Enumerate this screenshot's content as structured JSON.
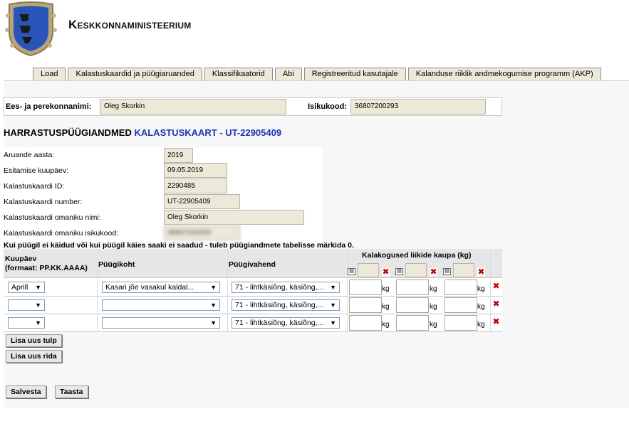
{
  "header": {
    "title": "Keskkonnaministeerium"
  },
  "tabs": [
    "Load",
    "Kalastuskaardid ja püügiaruanded",
    "Klassifikaatorid",
    "Abi",
    "Registreeritud kasutajale",
    "Kalanduse riiklik andmekogumise programm (AKP)"
  ],
  "person": {
    "name_label": "Ees- ja perekonnanimi:",
    "name_value": "Oleg Skorkin",
    "id_label": "Isikukood:",
    "id_value": "36807200293"
  },
  "heading": {
    "main": "HARRASTUSPÜÜGIANDMED",
    "sub": "KALASTUSKAART - UT-22905409"
  },
  "info": [
    {
      "label": "Aruande aasta:",
      "value": "2019"
    },
    {
      "label": "Esitamise kuupäev:",
      "value": "09.05.2019"
    },
    {
      "label": "Kalastuskaardi ID:",
      "value": "2290485"
    },
    {
      "label": "Kalastuskaardi number:",
      "value": "UT-22905409"
    },
    {
      "label": "Kalastuskaardi omaniku nimi:",
      "value": "Oleg Skorkin"
    },
    {
      "label": "Kalastuskaardi omaniku isikukood:",
      "value": "36807200293"
    }
  ],
  "notice": "Kui püügil ei käidud või kui püügil käies saaki ei saadud - tuleb püügiandmete tabelisse märkida 0.",
  "table": {
    "col_date_line1": "Kuupäev",
    "col_date_line2": "(formaat: PP.KK.AAAA)",
    "col_place": "Püügikoht",
    "col_gear": "Püügivahend",
    "col_catch": "Kalakogused liikide kaupa (kg)",
    "unit": "kg",
    "rows": [
      {
        "date": "Aprill",
        "place": "Kasari jõe vasakul kaldal...",
        "gear": "71 - lihtkäsiõng, käsiõng,..."
      },
      {
        "date": "",
        "place": "",
        "gear": "71 - lihtkäsiõng, käsiõng,..."
      },
      {
        "date": "",
        "place": "",
        "gear": "71 - lihtkäsiõng, käsiõng,..."
      }
    ]
  },
  "buttons": {
    "add_column": "Lisa uus tulp",
    "add_row": "Lisa uus rida",
    "save": "Salvesta",
    "reset": "Taasta"
  },
  "icons": {
    "dropdown": "▼",
    "delete": "✖"
  }
}
